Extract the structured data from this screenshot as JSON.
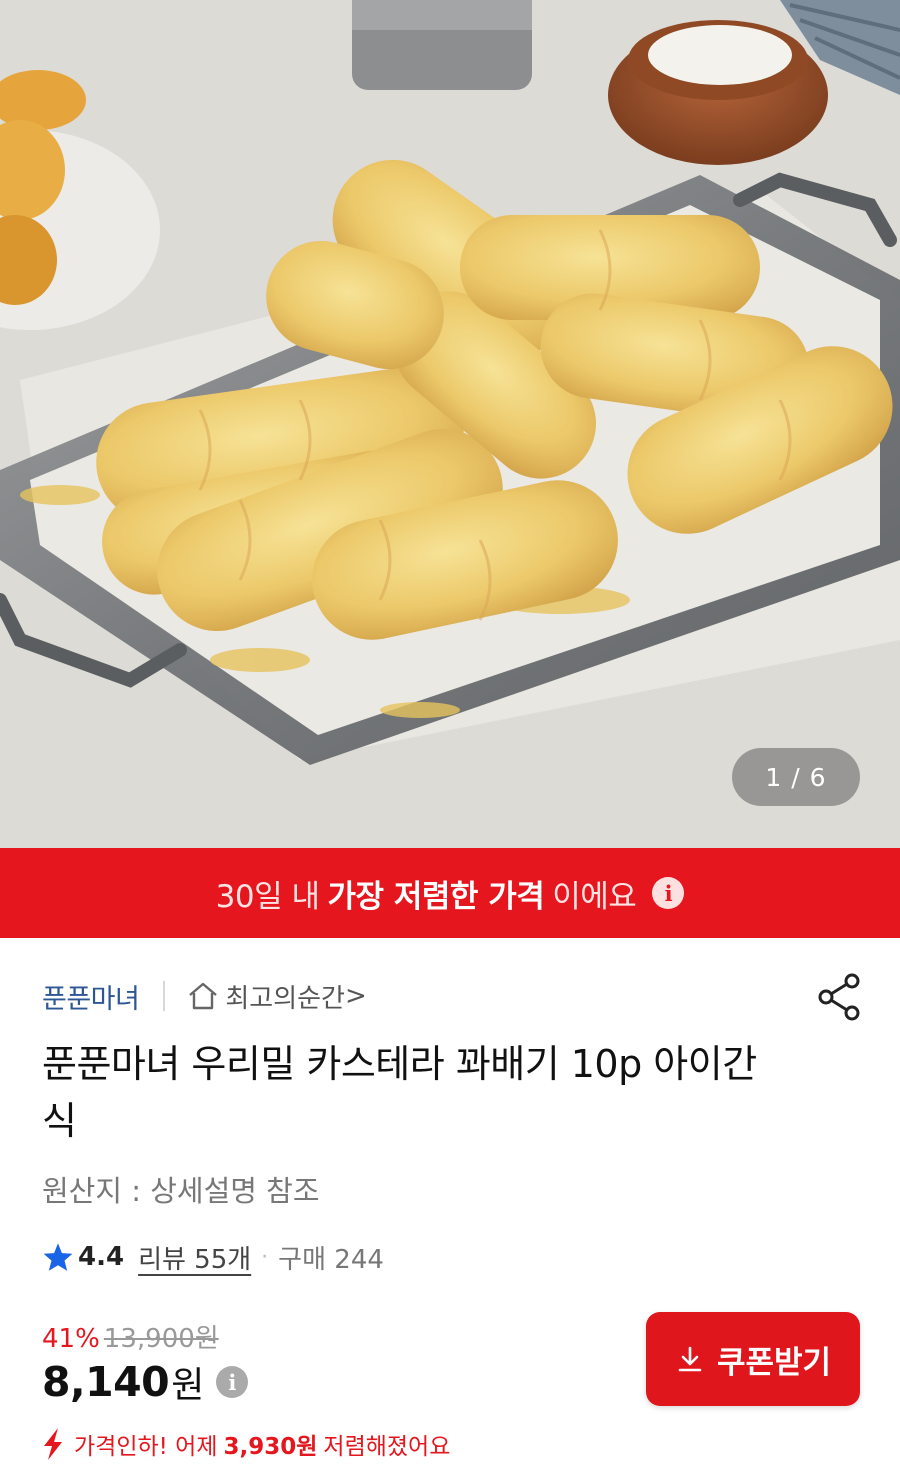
{
  "gallery": {
    "counter": "1 / 6"
  },
  "banner": {
    "prefix": "30일 내",
    "highlight": "가장 저렴한 가격",
    "suffix": "이에요",
    "info_glyph": "i"
  },
  "store": {
    "brand": "푼푼마녀",
    "shop_name": "최고의순간",
    "shop_chevron": ">"
  },
  "product": {
    "title": "푼푼마녀 우리밀 카스테라 꽈배기 10p 아이간식",
    "origin": "원산지 : 상세설명 참조",
    "rating": "4.4",
    "review_label": "리뷰 55개",
    "separator": "·",
    "purchase_label": "구매 244"
  },
  "price": {
    "discount": "41%",
    "original": "13,900원",
    "current": "8,140",
    "unit": "원",
    "info_glyph": "i",
    "drop_prefix": "가격인하! 어제",
    "drop_amount": "3,930원",
    "drop_suffix": "저렴해졌어요"
  },
  "actions": {
    "coupon_label": "쿠폰받기"
  },
  "colors": {
    "accent_red": "#e5161d",
    "brand_blue": "#2d5695",
    "star_blue": "#1a64e8"
  },
  "icons": [
    "home-icon",
    "share-icon",
    "star-icon",
    "info-icon",
    "download-icon",
    "price-drop-arrow-icon"
  ]
}
